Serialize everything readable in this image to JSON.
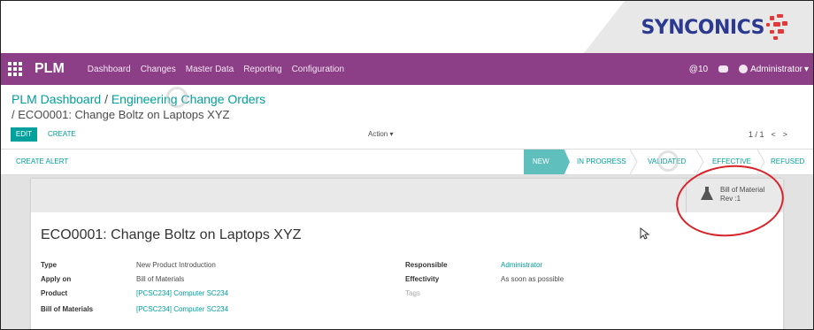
{
  "logo": {
    "text_a": "SYN",
    "text_o": "C",
    "text_b": "ONICS"
  },
  "nav": {
    "brand": "PLM",
    "menu": [
      "Dashboard",
      "Changes",
      "Master Data",
      "Reporting",
      "Configuration"
    ],
    "notifications": "10",
    "user": "Administrator"
  },
  "breadcrumb": {
    "root": "PLM Dashboard",
    "sep": "/",
    "parent": "Engineering Change Orders",
    "current": "/  ECO0001: Change Boltz on Laptops XYZ"
  },
  "buttons": {
    "edit": "EDIT",
    "create": "CREATE",
    "action": "Action",
    "create_alert": "CREATE ALERT"
  },
  "pager": {
    "value": "1 / 1",
    "prev": "<",
    "next": ">"
  },
  "stages": [
    "NEW",
    "IN PROGRESS",
    "VALIDATED",
    "EFFECTIVE",
    "REFUSED"
  ],
  "smart_button": {
    "label": "Bill of Material",
    "rev": "Rev :1"
  },
  "record": {
    "title": "ECO0001: Change Boltz on Laptops XYZ",
    "left": [
      {
        "label": "Type",
        "value": "New Product Introduction"
      },
      {
        "label": "Apply on",
        "value": "Bill of Materials"
      },
      {
        "label": "Product",
        "value": "[PCSC234] Computer SC234"
      },
      {
        "label": "Bill of Materials",
        "value": "[PCSC234] Computer SC234"
      }
    ],
    "right": [
      {
        "label": "Responsible",
        "value": "Administrator"
      },
      {
        "label": "Effectivity",
        "value": "As soon as possible"
      },
      {
        "label": "",
        "value": "Tags"
      }
    ]
  },
  "colors": {
    "nav": "#8c3e87",
    "accent": "#00a09d",
    "annotation": "#d8232a"
  }
}
